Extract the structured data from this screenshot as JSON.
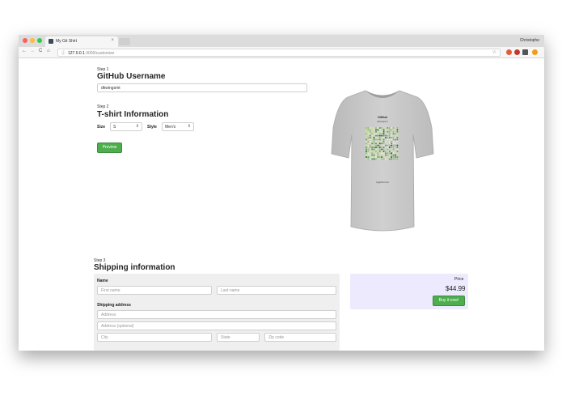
{
  "browser": {
    "tab_title": "My Git Shirt",
    "tab_close": "×",
    "user_name": "Christophe",
    "url_host": "127.0.0.1",
    "url_path": ":3000/customize",
    "nav": {
      "back": "←",
      "forward": "→",
      "reload": "C",
      "home": "⌂"
    },
    "url_info_icon": "ⓘ",
    "star_icon": "☆"
  },
  "step1": {
    "label": "Step 1",
    "heading": "GitHub Username",
    "username_value": "dkwingsmt"
  },
  "step2": {
    "label": "Step 2",
    "heading": "T-shirt Information",
    "size_label": "Size",
    "size_value": "S",
    "style_label": "Style",
    "style_value": "Men's",
    "preview_button": "Preview"
  },
  "shirt": {
    "title": "GitHub",
    "subtitle": "dkwingsmt",
    "footer": "mygitshirt.com"
  },
  "step3": {
    "label": "Step 3",
    "heading": "Shipping information",
    "name_label": "Name",
    "first_name_placeholder": "First name",
    "last_name_placeholder": "Last name",
    "address_label": "Shipping address",
    "address_placeholder": "Address",
    "address2_placeholder": "Address (optional)",
    "city_placeholder": "City",
    "state_placeholder": "State",
    "zip_placeholder": "Zip code"
  },
  "purchase": {
    "price_label": "Price",
    "price_value": "$44.99",
    "buy_button": "Buy it now!"
  },
  "colors": {
    "button_green": "#4cae4c",
    "contrib_dark": "#1e6823",
    "contrib_mid": "#44a340",
    "contrib_light": "#8cc665",
    "contrib_pale": "#d6e685"
  }
}
